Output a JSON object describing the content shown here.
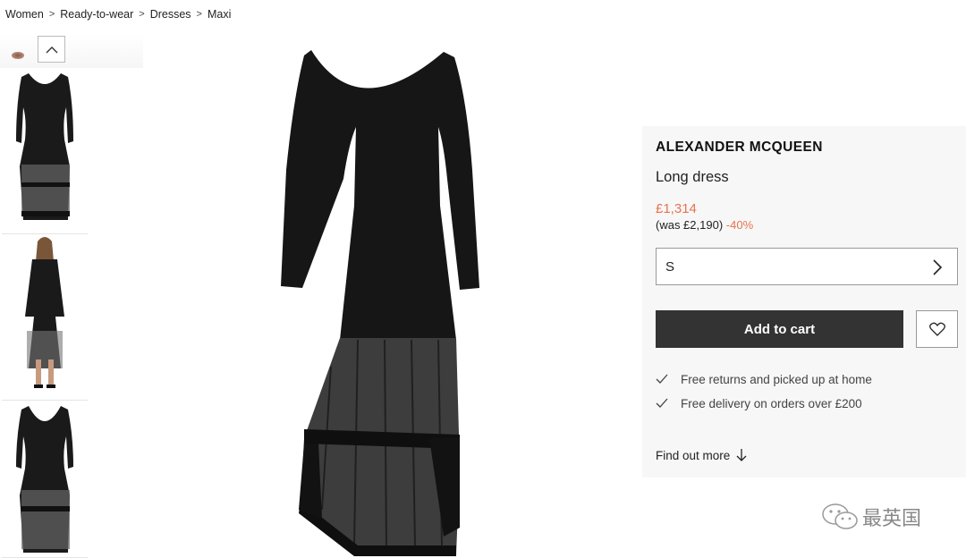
{
  "breadcrumb": [
    "Women",
    "Ready-to-wear",
    "Dresses",
    "Maxi"
  ],
  "product": {
    "brand": "ALEXANDER MCQUEEN",
    "name": "Long dress",
    "price": "£1,314",
    "was_prefix": "(was £2,190)",
    "discount": "-40%"
  },
  "size": {
    "selected": "S"
  },
  "actions": {
    "add_to_cart": "Add to cart"
  },
  "benefits": [
    "Free returns and picked up at home",
    "Free delivery on orders over £200"
  ],
  "find_out_more": "Find out more",
  "watermark": "最英国",
  "colors": {
    "accent": "#e8734e",
    "button": "#333333",
    "panel": "#f7f7f7"
  },
  "icons": [
    "chevron-up-icon",
    "chevron-right-icon",
    "heart-icon",
    "check-icon",
    "arrow-down-icon",
    "wechat-icon"
  ]
}
